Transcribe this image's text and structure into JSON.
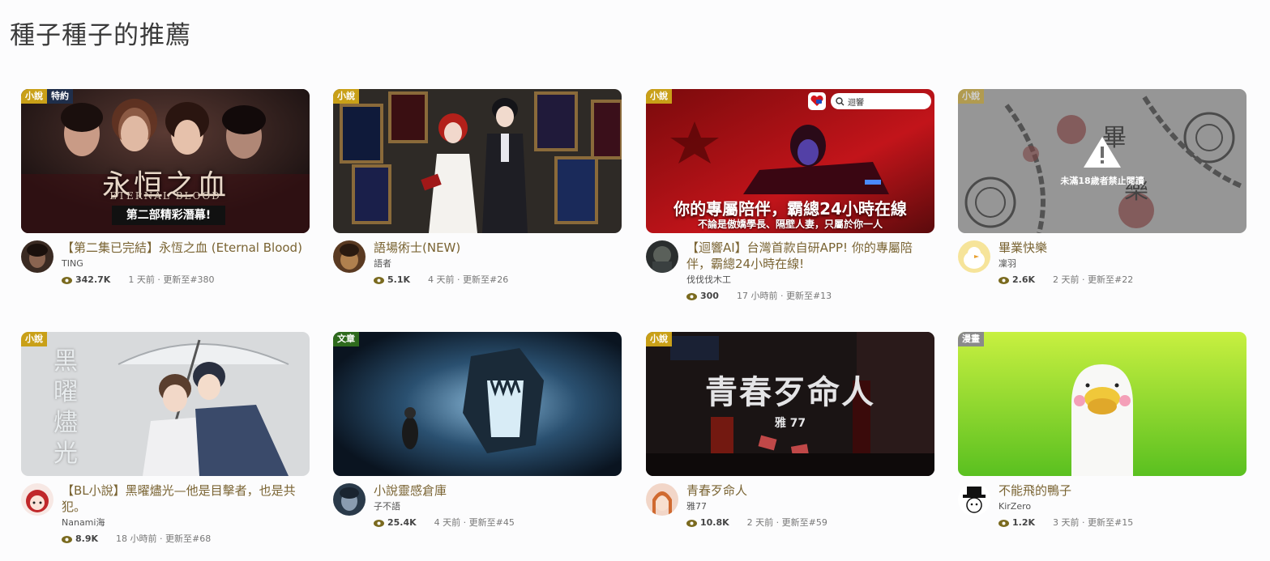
{
  "section": {
    "title": "種子種子的推薦"
  },
  "cards": [
    {
      "badges": [
        "小說",
        "特約"
      ],
      "cover_text": [
        "永恒之血",
        "ETERNAL BLOOD",
        "第二部精彩潛幕!"
      ],
      "title": "【第二集已完結】永恆之血 (Eternal Blood)",
      "author": "TING",
      "views": "342.7K",
      "updated": "1 天前 · 更新至#380"
    },
    {
      "badges": [
        "小說"
      ],
      "cover_text": [],
      "title": "語場術士(NEW)",
      "author": "語者",
      "views": "5.1K",
      "updated": "4 天前 · 更新至#26"
    },
    {
      "badges": [
        "小說"
      ],
      "cover_text": [
        "迴響",
        "你的專屬陪伴，霸總24小時在線",
        "不論是傲嬌學長、隔壁人妻，只屬於你一人"
      ],
      "title": "【迴響AI】台灣首款自研APP! 你的專屬陪伴，霸總24小時在線!",
      "author": "伐伐伐木工",
      "views": "300",
      "updated": "17 小時前 · 更新至#13"
    },
    {
      "badges": [
        "小說"
      ],
      "cover_text": [
        "未滿18歲者禁止閱讀"
      ],
      "title": "畢業快樂",
      "author": "凜羽",
      "views": "2.6K",
      "updated": "2 天前 · 更新至#22"
    },
    {
      "badges": [
        "小說"
      ],
      "cover_text": [
        "黑",
        "曜",
        "燼",
        "光"
      ],
      "title": "【BL小說】黑曜燼光—他是目擊者，也是共犯。",
      "author": "Nanami海",
      "views": "8.9K",
      "updated": "18 小時前 · 更新至#68"
    },
    {
      "badges": [
        "文章"
      ],
      "cover_text": [],
      "title": "小說靈感倉庫",
      "author": "子不語",
      "views": "25.4K",
      "updated": "4 天前 · 更新至#45"
    },
    {
      "badges": [
        "小說"
      ],
      "cover_text": [
        "青春歹命人",
        "雅 77"
      ],
      "title": "青春歹命人",
      "author": "雅77",
      "views": "10.8K",
      "updated": "2 天前 · 更新至#59"
    },
    {
      "badges": [
        "漫畫"
      ],
      "cover_text": [],
      "title": "不能飛的鴨子",
      "author": "KirZero",
      "views": "1.2K",
      "updated": "3 天前 · 更新至#15"
    }
  ],
  "colors": {
    "title_text": "#7a6433",
    "novel_badge": "#c9a018",
    "article_badge": "#2e6a1d",
    "comic_badge": "#8a8a8a",
    "eye_icon": "#7a6a1f"
  }
}
